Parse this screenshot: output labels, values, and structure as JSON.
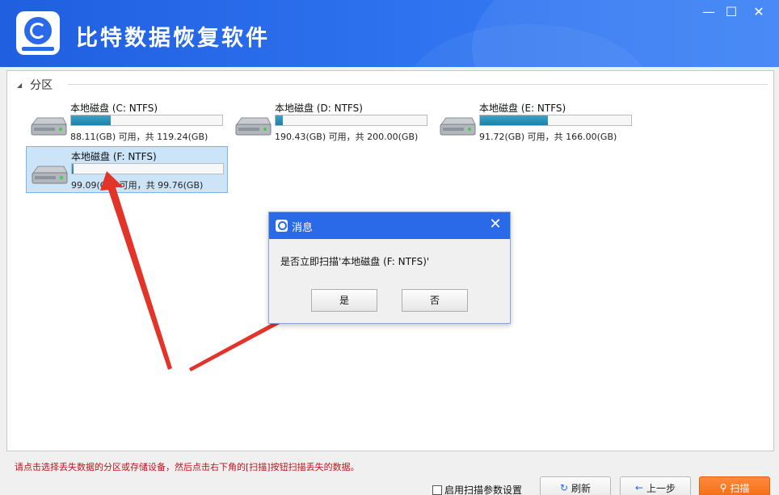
{
  "app": {
    "title": "比特数据恢复软件"
  },
  "window_controls": {
    "minimize": "—",
    "maximize": "☐",
    "close": "✕"
  },
  "section": {
    "label": "分区"
  },
  "drives": [
    {
      "name": "本地磁盘 (C: NTFS)",
      "info": "88.11(GB) 可用，共 119.24(GB)",
      "used_fraction": 0.26,
      "selected": false
    },
    {
      "name": "本地磁盘 (D: NTFS)",
      "info": "190.43(GB) 可用，共 200.00(GB)",
      "used_fraction": 0.05,
      "selected": false
    },
    {
      "name": "本地磁盘 (E: NTFS)",
      "info": "91.72(GB) 可用，共 166.00(GB)",
      "used_fraction": 0.45,
      "selected": false
    },
    {
      "name": "本地磁盘 (F: NTFS)",
      "info": "99.09(GB) 可用，共 99.76(GB)",
      "used_fraction": 0.01,
      "selected": true
    }
  ],
  "dialog": {
    "title": "消息",
    "close": "✕",
    "message": "是否立即扫描'本地磁盘 (F: NTFS)'",
    "yes": "是",
    "no": "否"
  },
  "hint": "请点击选择丢失数据的分区或存储设备，然后点击右下角的[扫描]按钮扫描丢失的数据。",
  "footer": {
    "scan_settings_label": "启用扫描参数设置",
    "refresh_label": "刷新",
    "back_label": "上一步",
    "scan_label": "扫描"
  },
  "colors": {
    "accent": "#2a6ae8",
    "progress": "#2a8fb8",
    "primary_button": "#f26b14",
    "hint_text": "#c0141b",
    "arrow": "#e3342a"
  }
}
